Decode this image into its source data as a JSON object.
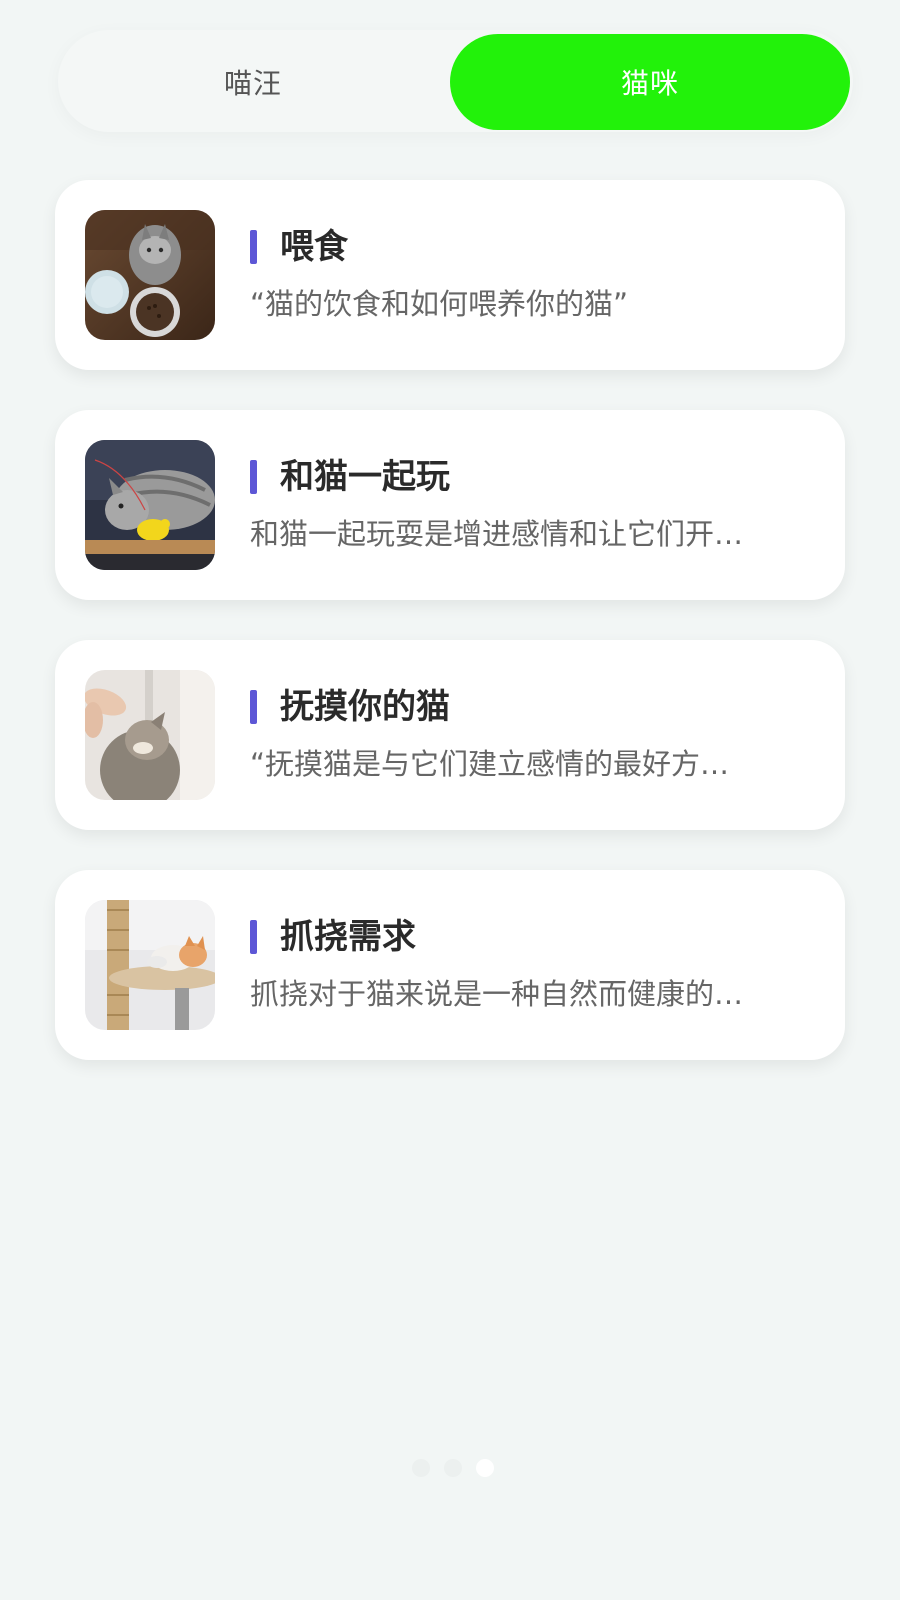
{
  "tabs": {
    "dog_label": "喵汪",
    "cat_label": "猫咪",
    "active_tab": "cat",
    "active_color": "#22f20a"
  },
  "cards": [
    {
      "title": "喂食",
      "description": "“猫的饮食和如何喂养你的猫”",
      "image": "cat-with-food-bowls"
    },
    {
      "title": "和猫一起玩",
      "description": "和猫一起玩耍是增进感情和让它们开…",
      "image": "cat-playing-with-toy"
    },
    {
      "title": "抚摸你的猫",
      "description": "“抚摸猫是与它们建立感情的最好方…",
      "image": "hand-petting-cat"
    },
    {
      "title": "抓挠需求",
      "description": "抓挠对于猫来说是一种自然而健康的…",
      "image": "kitten-on-scratching-post"
    }
  ],
  "accent_color": "#5d57d6",
  "pager": {
    "count": 3,
    "active_index": 2
  }
}
